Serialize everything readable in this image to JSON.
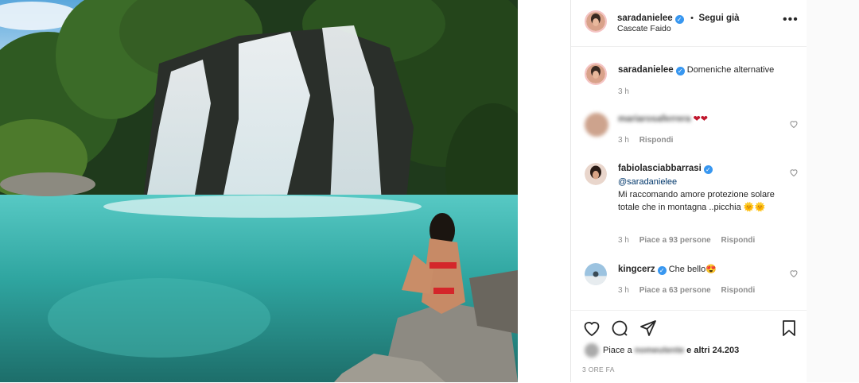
{
  "post": {
    "author": "saradanielee",
    "follow_separator": "•",
    "follow_label": "Segui già",
    "location": "Cascate Faido",
    "more_icon": "more-horizontal-icon"
  },
  "caption": {
    "username": "saradanielee",
    "text": "Domeniche alternative",
    "time": "3 h"
  },
  "comments": [
    {
      "username": "mariarosaferrera",
      "text": "❤❤",
      "time": "3 h",
      "reply_label": "Rispondi",
      "username_blurred": true
    },
    {
      "username": "fabiolasciabbarrasi",
      "mention": "@saradanielee",
      "text": "Mi raccomando amore protezione solare totale che in montagna ..picchia 🌞🌞",
      "time": "3 h",
      "likes": "Piace a 93 persone",
      "reply_label": "Rispondi"
    },
    {
      "username": "kingcerz",
      "text": "Che bello😍",
      "time": "3 h",
      "likes": "Piace a 63 persone",
      "reply_label": "Rispondi"
    }
  ],
  "likes_summary": {
    "prefix": "Piace a",
    "blurred_name": "nomeutente",
    "suffix": "e altri 24.203"
  },
  "timestamp": "3 ORE FA",
  "colors": {
    "verified": "#3897f0",
    "text": "#262626",
    "muted": "#8e8e8e",
    "heart": "#c0172d"
  }
}
